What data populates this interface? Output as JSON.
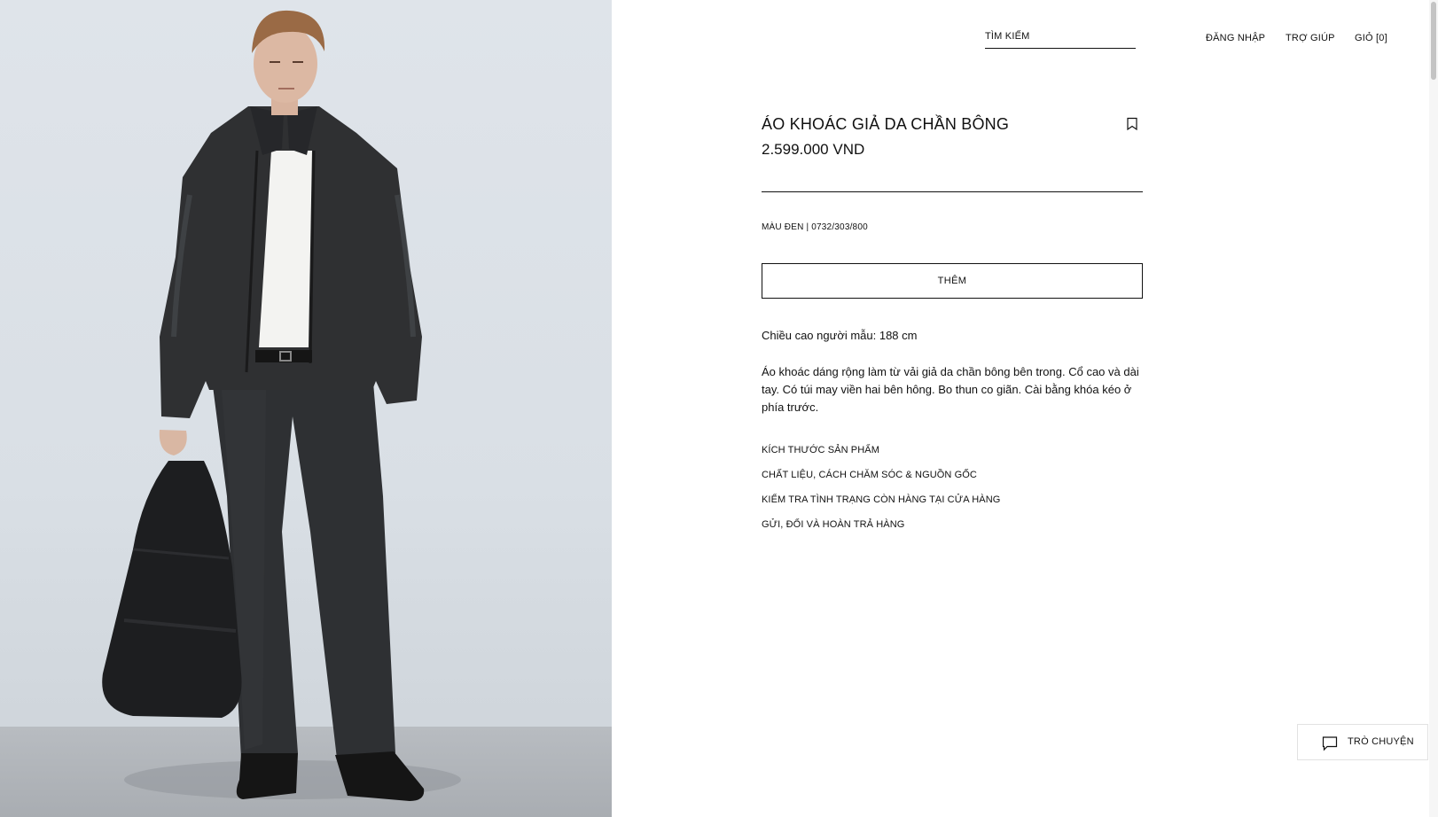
{
  "header": {
    "search_label": "TÌM KIẾM",
    "nav": {
      "login": "ĐĂNG NHẬP",
      "help": "TRỢ GIÚP",
      "cart": "GIỎ [0]"
    }
  },
  "product": {
    "title": "ÁO KHOÁC GIẢ DA CHẦN BÔNG",
    "price": "2.599.000 VND",
    "color_ref": "MÀU ĐEN | 0732/303/800",
    "add_button": "THÊM",
    "model_height": "Chiều cao người mẫu: 188 cm",
    "description": "Áo khoác dáng rộng làm từ vải giả da chần bông bên trong. Cổ cao và dài tay. Có túi may viền hai bên hông. Bo thun co giãn. Cài bằng khóa kéo ở phía trước.",
    "links": [
      "KÍCH THƯỚC SẢN PHẨM",
      "CHẤT LIỆU, CÁCH CHĂM SÓC & NGUỒN GỐC",
      "KIỂM TRA TÌNH TRẠNG CÒN HÀNG TẠI CỬA HÀNG",
      "GỬI, ĐỔI VÀ HOÀN TRẢ HÀNG"
    ]
  },
  "chat": {
    "label": "TRÒ CHUYỆN"
  },
  "icons": {
    "bookmark": "bookmark-icon",
    "chat": "chat-bubble-icon"
  },
  "colors": {
    "text": "#111111",
    "background": "#ffffff",
    "photo_backdrop": "#dde2e8"
  }
}
